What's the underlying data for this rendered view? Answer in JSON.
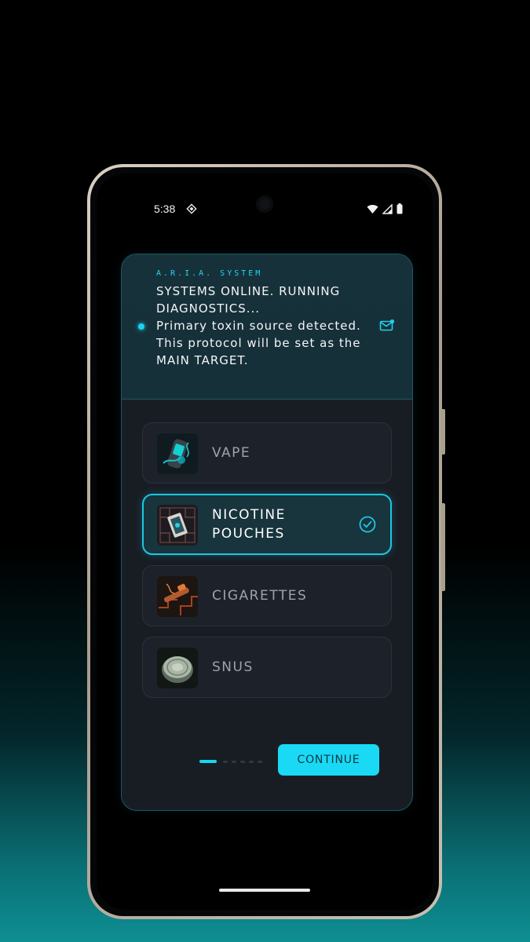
{
  "status_bar": {
    "time": "5:38"
  },
  "message": {
    "sender": "A.R.I.A. SYSTEM",
    "text": "SYSTEMS ONLINE. RUNNING DIAGNOSTICS...\nPrimary toxin source detected.\nThis protocol will be set as the MAIN TARGET."
  },
  "options": [
    {
      "label": "VAPE",
      "selected": false
    },
    {
      "label": "NICOTINE POUCHES",
      "selected": true
    },
    {
      "label": "CIGARETTES",
      "selected": false
    },
    {
      "label": "SNUS",
      "selected": false
    }
  ],
  "pager": {
    "current": 1,
    "total": 6
  },
  "continue_button": {
    "label": "CONTINUE"
  },
  "colors": {
    "accent": "#1ad9f5",
    "card_background": "#181d24",
    "message_background": "#17313a",
    "selected_option_background": "#18343d"
  }
}
